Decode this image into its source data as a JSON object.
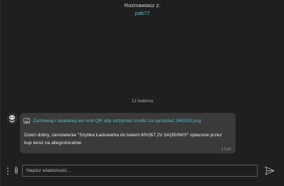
{
  "header": {
    "label": "Rozmawiasz z:",
    "username": "pab77"
  },
  "conversation": {
    "date_separator": "12 kwietnia",
    "messages": [
      {
        "attachment": {
          "icon": "image-file-icon",
          "file_name": "Zachowaj i zeskanuj ten kod-QR aby otrzymać środki za sprzedaż.265333.png"
        },
        "text": "Dzień dobry, zamówienie \"Szybka Ładowarka do baterii 60V|67,2V 5A|350W!!!\" opłacone przez kup teraz na allegrolocalnie",
        "time": "17:07"
      }
    ]
  },
  "composer": {
    "placeholder": "Napisz wiadomość...",
    "value": "",
    "menu_icon": "more-vertical-icon",
    "attach_icon": "paperclip-icon",
    "send_icon": "send-icon"
  },
  "colors": {
    "background": "#1f1f1f",
    "bubble": "#3a3a3a",
    "accent": "#4fc1c9"
  }
}
